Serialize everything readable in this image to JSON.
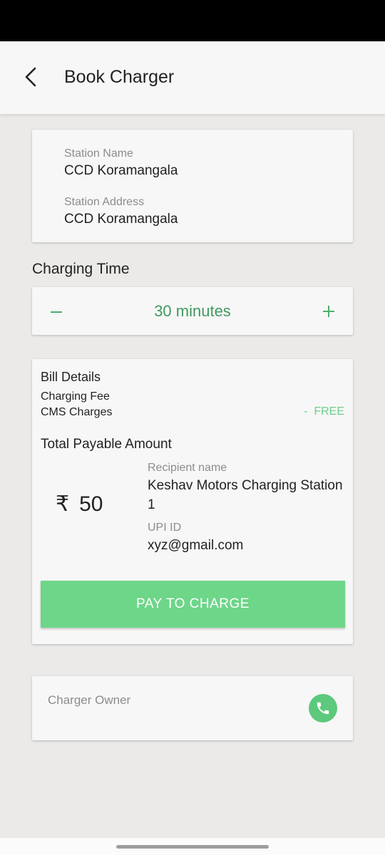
{
  "header": {
    "title": "Book Charger"
  },
  "station": {
    "name_label": "Station Name",
    "name_value": "CCD Koramangala",
    "address_label": "Station Address",
    "address_value": "CCD Koramangala"
  },
  "charging_time": {
    "title": "Charging Time",
    "value": "30 minutes"
  },
  "bill": {
    "title": "Bill Details",
    "charging_fee_label": "Charging Fee",
    "cms_charges_label": "CMS Charges",
    "free_text": "-  FREE",
    "total_label": "Total Payable Amount",
    "currency_symbol": "₹",
    "amount": "50",
    "recipient_label": "Recipient name",
    "recipient_value": "Keshav Motors Charging Station 1",
    "upi_label": "UPI ID",
    "upi_value": "xyz@gmail.com",
    "pay_button": "PAY TO CHARGE"
  },
  "owner": {
    "label": "Charger Owner"
  },
  "colors": {
    "accent": "#6dd689",
    "accent_text": "#3f9a60",
    "background": "#ebeae8",
    "card": "#f7f7f7"
  },
  "icons": {
    "back": "arrow-back-icon",
    "minus": "minus-icon",
    "plus": "plus-icon",
    "phone": "phone-icon"
  }
}
